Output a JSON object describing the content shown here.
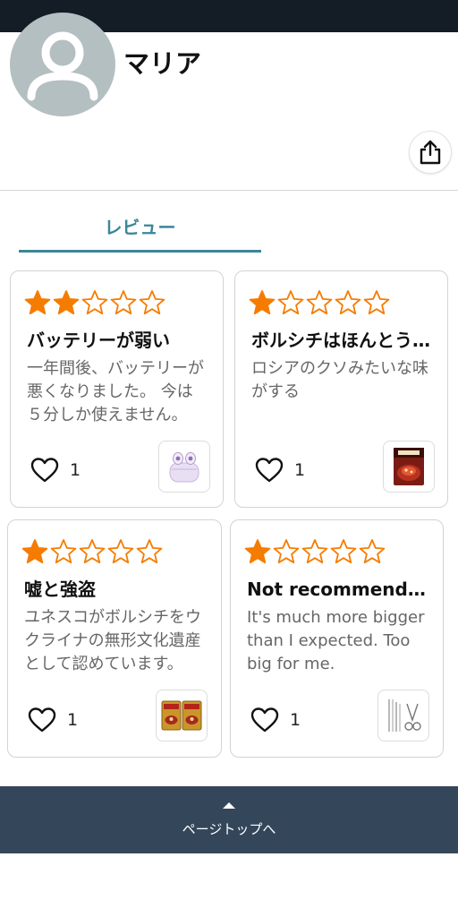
{
  "profile": {
    "name": "マリア",
    "avatar_icon": "user-avatar-placeholder-icon",
    "share_icon": "share-icon"
  },
  "tabs": [
    {
      "label": "レビュー",
      "active": true
    }
  ],
  "reviews": [
    {
      "rating": 2,
      "max_rating": 5,
      "title": "バッテリーが弱い",
      "body": "一年間後、バッテリーが悪くなりました。 今は５分しか使えません。",
      "likes": "1",
      "product_icon": "wireless-earbuds-image"
    },
    {
      "rating": 1,
      "max_rating": 5,
      "title": "ボルシチはほんとうにまずい",
      "body": "ロシアのクソみたいな味がする",
      "likes": "1",
      "product_icon": "borscht-soup-package-image"
    },
    {
      "rating": 1,
      "max_rating": 5,
      "title": "嘘と強盗",
      "body": "ユネスコがボルシチをウクライナの無形文化遺産として認めています。",
      "likes": "1",
      "product_icon": "soup-packages-image"
    },
    {
      "rating": 1,
      "max_rating": 5,
      "title": "Not recommended at all",
      "body": "It's much more bigger than I expected. Too big for me.",
      "likes": "1",
      "product_icon": "manicure-tool-set-image"
    }
  ],
  "footer": {
    "label": "ページトップへ",
    "icon": "arrow-up-icon"
  },
  "colors": {
    "accent": "#3a8799",
    "star": "#f57c00",
    "footer_bg": "#34465a",
    "status_bar": "#141c26",
    "avatar_bg": "#b3bfc1"
  }
}
